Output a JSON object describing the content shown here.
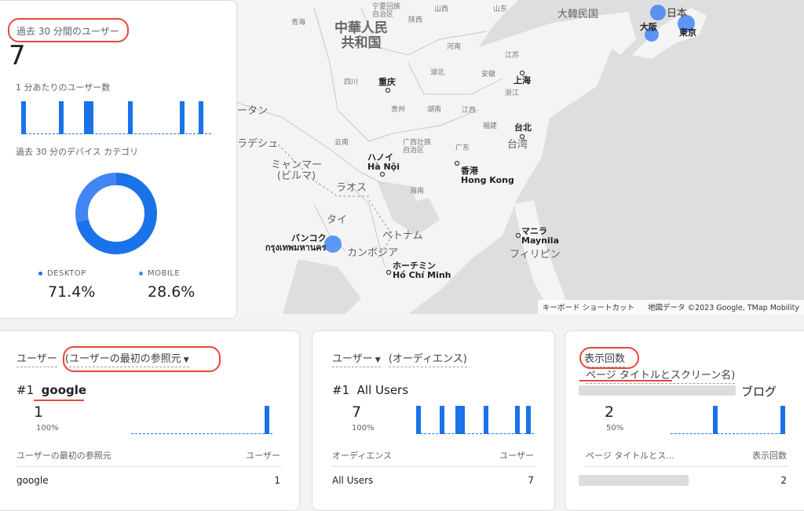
{
  "map": {
    "labels": {
      "china": "中華人民\n共和国",
      "korea": "大韓民国",
      "japan": "日本",
      "osaka": "大阪",
      "tokyo": "東京",
      "qinghai": "青海",
      "ningxia": "宁夏回族\n自治区",
      "shaanxi": "陕西",
      "shanxi": "山西",
      "shandong": "山东",
      "henan": "河南",
      "jiangsu": "江苏",
      "sichuan": "四川",
      "chongqing": "重庆",
      "hubei": "湖北",
      "anhui": "安徽",
      "shanghai": "上海",
      "zhejiang": "浙江",
      "guizhou": "贵州",
      "hunan": "湖南",
      "jiangxi": "江西",
      "fujian": "福建",
      "taipei": "台北",
      "taiwan": "台湾",
      "yunnan": "云南",
      "guangxi": "广西壮族\n自治区",
      "guangdong": "广东",
      "hongkong_ja": "香港",
      "hongkong_en": "Hong Kong",
      "hainan": "海南",
      "hanoi_ja": "ハノイ",
      "hanoi_vi": "Hà Nội",
      "myanmar": "ミャンマー\n(ビルマ)",
      "laos": "ラオス",
      "thailand": "タイ",
      "vietnam": "ベトナム",
      "cambodia": "カンボジア",
      "bangkok_ja": "バンコク",
      "bangkok_th": "กรุงเทพมหานคร",
      "hcm_ja": "ホーチミン",
      "hcm_vi": "Hồ Chí Minh",
      "manila_ja": "マニラ",
      "manila_en": "Maynila",
      "philippines": "フィリピン",
      "bhutan_part": "ータン",
      "bangladesh_part": "ラデシュ"
    },
    "attribution": {
      "shortcuts": "キーボード ショートカット",
      "mapdata": "地図データ ©2023 Google, TMap Mobility"
    }
  },
  "realtime": {
    "title": "過去 30 分間のユーザー",
    "count": "7",
    "per_minute_label": "1 分あたりのユーザー数",
    "device_title": "過去 30 分のデバイス カテゴリ",
    "devices": [
      {
        "name": "DESKTOP",
        "value": "71.4%",
        "share": 0.714,
        "color": "#1a73e8"
      },
      {
        "name": "MOBILE",
        "value": "28.6%",
        "share": 0.286,
        "color": "#4285f4"
      }
    ],
    "minute_bars": [
      1,
      1,
      1,
      1,
      1,
      1,
      1
    ]
  },
  "card_source": {
    "metric": "ユーザー",
    "dimension": "(ユーザーの最初の参照元",
    "rank": "#1",
    "top_name": "google",
    "value": "1",
    "pct": "100%",
    "col_dim": "ユーザーの最初の参照元",
    "col_metric": "ユーザー",
    "row_name": "google",
    "row_value": "1"
  },
  "card_audience": {
    "metric": "ユーザー",
    "dimension": "(オーディエンス)",
    "rank": "#1",
    "top_name": "All Users",
    "value": "7",
    "pct": "100%",
    "col_dim": "オーディエンス",
    "col_metric": "ユーザー",
    "row_name": "All Users",
    "row_value": "7"
  },
  "card_views": {
    "metric": "表示回数",
    "dimension": "ページ タイトルとスクリーン名)",
    "top_name_suffix": "ブログ",
    "value": "2",
    "pct": "50%",
    "col_dim": "ページ タイトルとス...",
    "col_metric": "表示回数",
    "row_value": "2"
  },
  "colors": {
    "accent": "#1a73e8",
    "annotation": "#e8473b"
  }
}
